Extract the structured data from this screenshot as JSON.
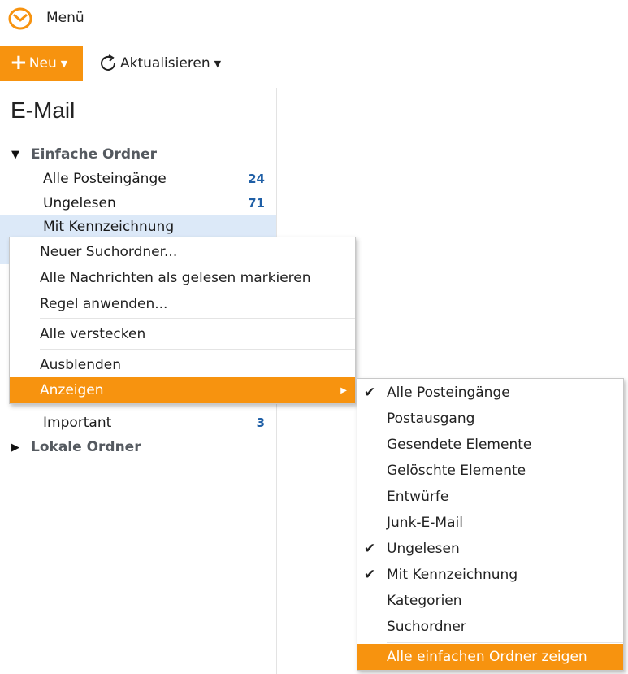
{
  "header": {
    "menu_label": "Menü"
  },
  "toolbar": {
    "new_label": "Neu",
    "refresh_label": "Aktualisieren"
  },
  "sidebar": {
    "title": "E-Mail",
    "group_simple": "Einfache Ordner",
    "items": [
      {
        "label": "Alle Posteingänge",
        "count": "24"
      },
      {
        "label": "Ungelesen",
        "count": "71"
      },
      {
        "label": "Mit Kennzeichnung",
        "count": ""
      },
      {
        "label": "Important",
        "count": "3"
      }
    ],
    "group_local": "Lokale Ordner"
  },
  "context_menu": {
    "items": [
      {
        "label": "Neuer Suchordner..."
      },
      {
        "label": "Alle Nachrichten als gelesen markieren"
      },
      {
        "label": "Regel anwenden..."
      },
      {
        "label": "Alle verstecken"
      },
      {
        "label": "Ausblenden"
      },
      {
        "label": "Anzeigen"
      }
    ]
  },
  "submenu": {
    "items": [
      {
        "label": "Alle Posteingänge",
        "checked": "✔"
      },
      {
        "label": "Postausgang",
        "checked": ""
      },
      {
        "label": "Gesendete Elemente",
        "checked": ""
      },
      {
        "label": "Gelöschte Elemente",
        "checked": ""
      },
      {
        "label": "Entwürfe",
        "checked": ""
      },
      {
        "label": "Junk-E-Mail",
        "checked": ""
      },
      {
        "label": "Ungelesen",
        "checked": "✔"
      },
      {
        "label": "Mit Kennzeichnung",
        "checked": "✔"
      },
      {
        "label": "Kategorien",
        "checked": ""
      },
      {
        "label": "Suchordner",
        "checked": ""
      },
      {
        "label": "Alle einfachen Ordner zeigen",
        "checked": ""
      }
    ]
  },
  "colors": {
    "accent": "#f7930f",
    "selected": "#dce9f8",
    "count": "#1f5fa6"
  }
}
